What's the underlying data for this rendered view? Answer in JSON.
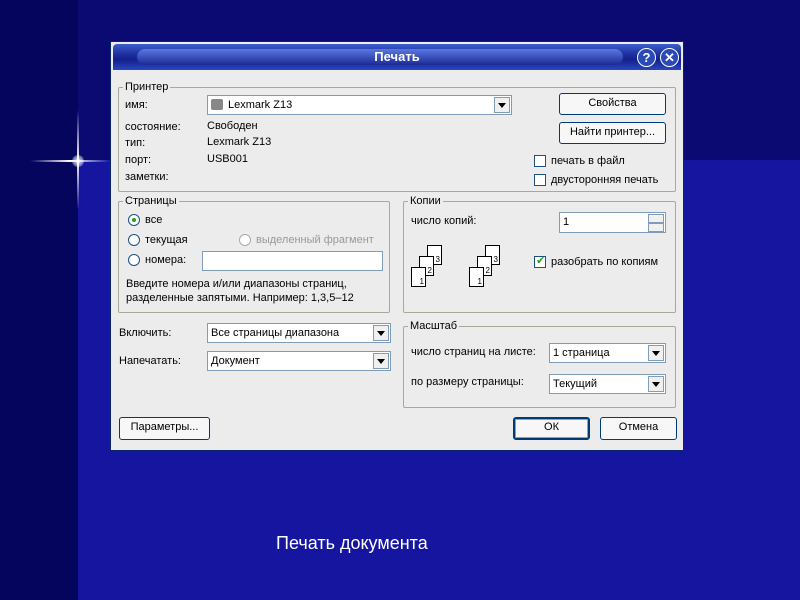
{
  "dialog": {
    "title": "Печать",
    "help_label": "?",
    "close_label": "✕"
  },
  "printer": {
    "group_label": "Принтер",
    "name_label": "имя:",
    "name_value": "Lexmark Z13",
    "status_label": "состояние:",
    "status_value": "Свободен",
    "type_label": "тип:",
    "type_value": "Lexmark Z13",
    "port_label": "порт:",
    "port_value": "USB001",
    "notes_label": "заметки:",
    "properties_button": "Свойства",
    "find_button": "Найти принтер...",
    "print_to_file": "печать в файл",
    "duplex": "двусторонняя печать"
  },
  "pages": {
    "group_label": "Страницы",
    "all": "все",
    "current": "текущая",
    "selection": "выделенный фрагмент",
    "numbers": "номера:",
    "hint_line1": "Введите номера и/или диапазоны страниц,",
    "hint_line2": "разделенные запятыми. Например: 1,3,5–12"
  },
  "copies": {
    "group_label": "Копии",
    "count_label": "число копий:",
    "count_value": "1",
    "collate": "разобрать по копиям",
    "page_numbers": [
      "1",
      "2",
      "3"
    ]
  },
  "include": {
    "label": "Включить:",
    "value": "Все страницы диапазона"
  },
  "print_what": {
    "label": "Напечатать:",
    "value": "Документ"
  },
  "scale": {
    "group_label": "Масштаб",
    "pages_per_sheet_label": "число страниц на листе:",
    "pages_per_sheet_value": "1 страница",
    "fit_label": "по размеру страницы:",
    "fit_value": "Текущий"
  },
  "buttons": {
    "options": "Параметры...",
    "ok": "ОК",
    "cancel": "Отмена"
  },
  "slide_caption": "Печать документа"
}
